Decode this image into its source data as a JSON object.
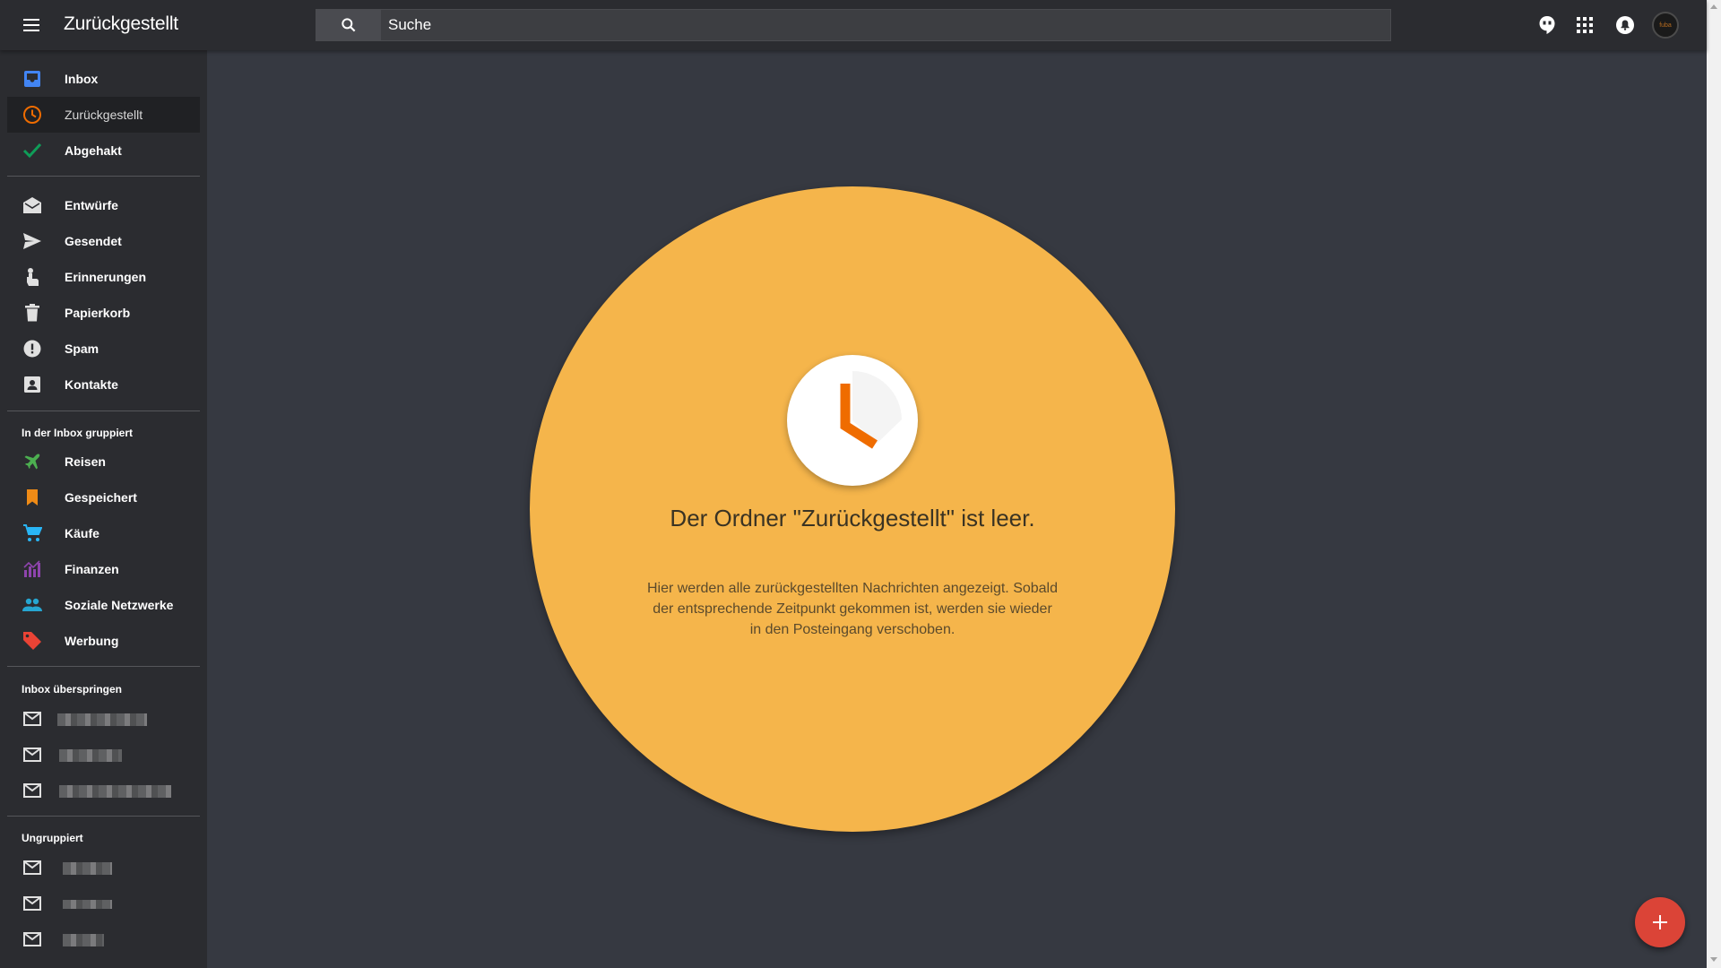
{
  "header": {
    "title": "Zurückgestellt",
    "search_placeholder": "Suche"
  },
  "sidebar": {
    "main_items": [
      {
        "label": "Inbox",
        "icon": "inbox-icon",
        "color": "#4285f4"
      },
      {
        "label": "Zurückgestellt",
        "icon": "clock-icon",
        "color": "#ef6c00"
      },
      {
        "label": "Abgehakt",
        "icon": "check-icon",
        "color": "#0f9d58"
      }
    ],
    "folders": [
      {
        "label": "Entwürfe",
        "icon": "drafts-icon"
      },
      {
        "label": "Gesendet",
        "icon": "send-icon"
      },
      {
        "label": "Erinnerungen",
        "icon": "reminder-icon"
      },
      {
        "label": "Papierkorb",
        "icon": "trash-icon"
      },
      {
        "label": "Spam",
        "icon": "spam-icon"
      },
      {
        "label": "Kontakte",
        "icon": "contacts-icon"
      }
    ],
    "grouped_heading": "In der Inbox gruppiert",
    "grouped": [
      {
        "label": "Reisen",
        "icon": "plane-icon",
        "color": "#4caf50"
      },
      {
        "label": "Gespeichert",
        "icon": "bookmark-icon",
        "color": "#ef8b16"
      },
      {
        "label": "Käufe",
        "icon": "cart-icon",
        "color": "#29b6f6"
      },
      {
        "label": "Finanzen",
        "icon": "chart-icon",
        "color": "#8e44ad"
      },
      {
        "label": "Soziale Netzwerke",
        "icon": "people-icon",
        "color": "#26a6d1"
      },
      {
        "label": "Werbung",
        "icon": "tag-icon",
        "color": "#ea4335"
      }
    ],
    "skip_heading": "Inbox überspringen",
    "ungrouped_heading": "Ungruppiert"
  },
  "main": {
    "empty_title": "Der Ordner \"Zurückgestellt\" ist leer.",
    "empty_description": "Hier werden alle zurückgestellten Nachrichten angezeigt. Sobald der entsprechende Zeitpunkt gekommen ist, werden sie wieder in den Posteingang verschoben.",
    "accent_color": "#f5b54b"
  },
  "avatar_text": "fuba"
}
